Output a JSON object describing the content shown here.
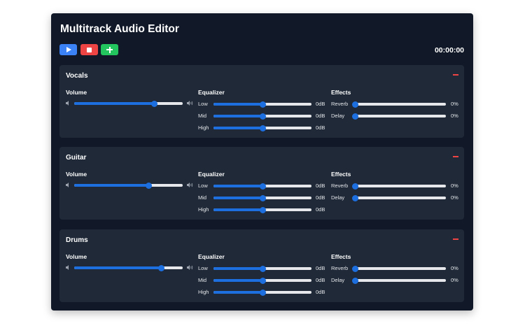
{
  "app": {
    "title": "Multitrack Audio Editor",
    "time": "00:00:00",
    "colors": {
      "panel": "#111827",
      "track": "#1f2937",
      "accent": "#1d6fe0",
      "play": "#3b82f6",
      "stop": "#ef4444",
      "add": "#22c55e"
    }
  },
  "toolbar": {
    "play_icon": "play-icon",
    "stop_icon": "stop-icon",
    "add_icon": "plus-icon"
  },
  "labels": {
    "volume": "Volume",
    "equalizer": "Equalizer",
    "effects": "Effects",
    "low": "Low",
    "mid": "Mid",
    "high": "High",
    "reverb": "Reverb",
    "delay": "Delay"
  },
  "tracks": [
    {
      "name": "Vocals",
      "volume": 0.74,
      "eq": {
        "low": "0dB",
        "mid": "0dB",
        "high": "0dB",
        "low_level": 0.5,
        "mid_level": 0.5,
        "high_level": 0.5
      },
      "fx": {
        "reverb": "0%",
        "delay": "0%",
        "reverb_level": 0,
        "delay_level": 0
      }
    },
    {
      "name": "Guitar",
      "volume": 0.69,
      "eq": {
        "low": "0dB",
        "mid": "0dB",
        "high": "0dB",
        "low_level": 0.5,
        "mid_level": 0.5,
        "high_level": 0.5
      },
      "fx": {
        "reverb": "0%",
        "delay": "0%",
        "reverb_level": 0,
        "delay_level": 0
      }
    },
    {
      "name": "Drums",
      "volume": 0.8,
      "eq": {
        "low": "0dB",
        "mid": "0dB",
        "high": "0dB",
        "low_level": 0.5,
        "mid_level": 0.5,
        "high_level": 0.5
      },
      "fx": {
        "reverb": "0%",
        "delay": "0%",
        "reverb_level": 0,
        "delay_level": 0
      }
    }
  ]
}
